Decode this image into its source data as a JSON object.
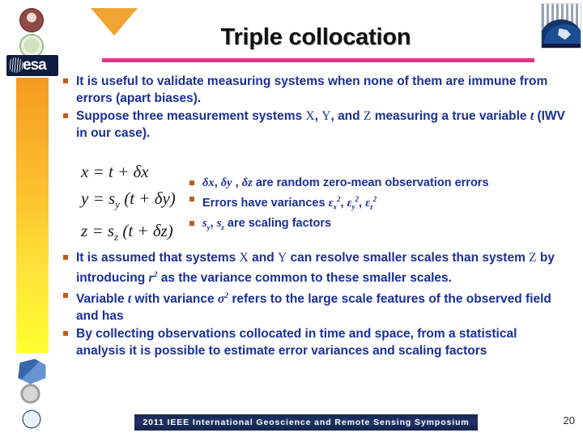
{
  "slide": {
    "title": "Triple collocation",
    "page_number": "20",
    "footer_banner": "2011 IEEE International Geoscience and Remote Sensing Symposium",
    "accent_rule_color": "#e5338b",
    "bullet_text_color": "#1b2f97",
    "bullet_marker_color": "#c25a20",
    "triangle_color": "#f0a431"
  },
  "branding": {
    "esa_wordmark": "esa",
    "left_logos": [
      "ifac-seal-logo",
      "green-seal-logo",
      "esa-wordmark-logo"
    ],
    "left_bottom_icons": [
      "cube-icon",
      "coin-icon",
      "institute-seal-icon"
    ],
    "top_right_badge": "esa-earth-observation-icon"
  },
  "top_bullets": [
    {
      "parts": [
        {
          "t": "text",
          "v": "It is useful to validate measuring systems when none of them are immune from errors (apart biases)."
        }
      ]
    },
    {
      "parts": [
        {
          "t": "text",
          "v": "Suppose three measurement systems "
        },
        {
          "t": "var",
          "v": "X"
        },
        {
          "t": "text",
          "v": ", "
        },
        {
          "t": "var",
          "v": "Y"
        },
        {
          "t": "text",
          "v": ", and "
        },
        {
          "t": "var",
          "v": "Z"
        },
        {
          "t": "text",
          "v": " measuring a true variable "
        },
        {
          "t": "ivar",
          "v": "t"
        },
        {
          "t": "text",
          "v": " (IWV in our case)."
        }
      ]
    }
  ],
  "equations": [
    {
      "lhs": "x",
      "rhs_pre": "= t + ",
      "delta": "δx",
      "scale": "",
      "paren": false
    },
    {
      "lhs": "y",
      "rhs_pre": "= s",
      "sub": "y",
      "delta": "δy",
      "paren": true,
      "inner_pre": "(t + ",
      "inner_post": ")"
    },
    {
      "lhs": "z",
      "rhs_pre": "= s",
      "sub": "z",
      "delta": "δz",
      "paren": true,
      "inner_pre": "(t + ",
      "inner_post": ")"
    }
  ],
  "equation_lines": [
    "x = t + δx",
    "y = s_y (t + δy)",
    "z = s_z (t + δz)"
  ],
  "mid_bullets": [
    {
      "parts": [
        {
          "t": "ivar",
          "v": "δx"
        },
        {
          "t": "text",
          "v": ", "
        },
        {
          "t": "ivar",
          "v": "δy"
        },
        {
          "t": "text",
          "v": " , "
        },
        {
          "t": "ivar",
          "v": "δz"
        },
        {
          "t": "text",
          "v": " are random zero-mean observation errors"
        }
      ]
    },
    {
      "parts": [
        {
          "t": "text",
          "v": "Errors have variances "
        },
        {
          "t": "ivar",
          "v": "ε"
        },
        {
          "t": "sub",
          "v": "x"
        },
        {
          "t": "sup",
          "v": "2"
        },
        {
          "t": "text",
          "v": ", "
        },
        {
          "t": "ivar",
          "v": "ε"
        },
        {
          "t": "sub",
          "v": "y"
        },
        {
          "t": "sup",
          "v": "2"
        },
        {
          "t": "text",
          "v": ", "
        },
        {
          "t": "ivar",
          "v": "ε"
        },
        {
          "t": "sub",
          "v": "z"
        },
        {
          "t": "sup",
          "v": "2"
        }
      ]
    },
    {
      "parts": [
        {
          "t": "ivar",
          "v": "s"
        },
        {
          "t": "sub",
          "v": "y"
        },
        {
          "t": "text",
          "v": ", "
        },
        {
          "t": "ivar",
          "v": "s"
        },
        {
          "t": "sub",
          "v": "z"
        },
        {
          "t": "text",
          "v": " are scaling factors"
        }
      ]
    }
  ],
  "lower_bullets": [
    {
      "parts": [
        {
          "t": "text",
          "v": "It is assumed that systems "
        },
        {
          "t": "var",
          "v": "X"
        },
        {
          "t": "text",
          "v": " and "
        },
        {
          "t": "var",
          "v": "Y"
        },
        {
          "t": "text",
          "v": " can resolve smaller scales than system "
        },
        {
          "t": "var",
          "v": "Z"
        },
        {
          "t": "text",
          "v": " by introducing "
        },
        {
          "t": "ivar",
          "v": "r"
        },
        {
          "t": "sup",
          "v": "2"
        },
        {
          "t": "text",
          "v": " as the variance common to these smaller scales."
        }
      ]
    },
    {
      "parts": [
        {
          "t": "text",
          "v": "Variable "
        },
        {
          "t": "ivar",
          "v": "t"
        },
        {
          "t": "text",
          "v": " with variance "
        },
        {
          "t": "ivar",
          "v": "σ"
        },
        {
          "t": "sup",
          "v": "2"
        },
        {
          "t": "text",
          "v": " refers to the large scale features of the observed field and has"
        }
      ]
    },
    {
      "parts": [
        {
          "t": "text",
          "v": "By collecting observations collocated in time and space, from a statistical analysis it is possible to estimate error variances and scaling factors"
        }
      ]
    }
  ]
}
